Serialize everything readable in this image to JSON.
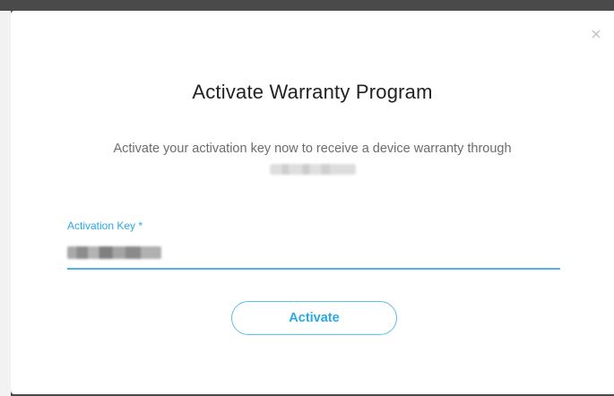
{
  "modal": {
    "title": "Activate Warranty Program",
    "description": "Activate your activation key now to receive a device warranty through",
    "close_icon": "close-icon"
  },
  "form": {
    "activation_key_label": "Activation Key *"
  },
  "actions": {
    "activate_label": "Activate"
  },
  "colors": {
    "accent": "#29a9e6",
    "text_primary": "#222222",
    "text_secondary": "#6c6c6c"
  }
}
